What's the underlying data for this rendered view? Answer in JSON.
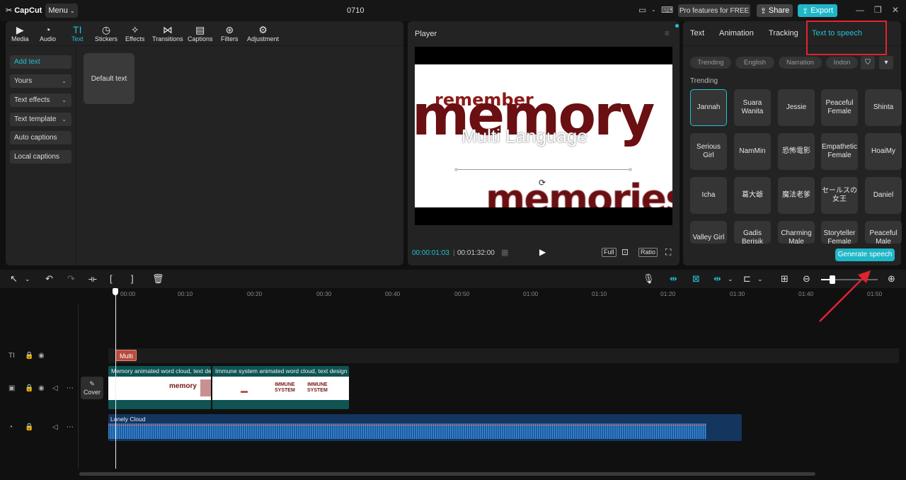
{
  "app": {
    "logo_text": "CapCut",
    "menu_label": "Menu",
    "project_title": "0710",
    "pro_label": "Pro features for FREE",
    "share_label": "Share",
    "export_label": "Export"
  },
  "toolbar": {
    "items": [
      {
        "label": "Media",
        "icon": "media-icon"
      },
      {
        "label": "Audio",
        "icon": "audio-icon"
      },
      {
        "label": "Text",
        "icon": "text-icon"
      },
      {
        "label": "Stickers",
        "icon": "stickers-icon"
      },
      {
        "label": "Effects",
        "icon": "effects-icon"
      },
      {
        "label": "Transitions",
        "icon": "transitions-icon"
      },
      {
        "label": "Captions",
        "icon": "captions-icon"
      },
      {
        "label": "Filters",
        "icon": "filters-icon"
      },
      {
        "label": "Adjustment",
        "icon": "adjustment-icon"
      }
    ],
    "active": "Text"
  },
  "text_sidebar": {
    "items": [
      {
        "label": "Add text"
      },
      {
        "label": "Yours"
      },
      {
        "label": "Text effects"
      },
      {
        "label": "Text template"
      },
      {
        "label": "Auto captions"
      },
      {
        "label": "Local captions"
      }
    ],
    "default_text_card": "Default text"
  },
  "player": {
    "title": "Player",
    "current_time": "00:00:01:03",
    "total_time": "00:01:32:00",
    "full_label": "Full",
    "ratio_label": "Ratio",
    "preview_words": {
      "remember": "remember",
      "memory": "memory",
      "overlay": "Multi Language",
      "memories": "memories"
    }
  },
  "right_panel": {
    "tabs": [
      "Text",
      "Animation",
      "Tracking",
      "Text to speech"
    ],
    "active_tab": "Text to speech",
    "filters": [
      "Trending",
      "English",
      "Narration",
      "Indon"
    ],
    "section_title": "Trending",
    "voices": [
      "Jannah",
      "Suara Wanita",
      "Jessie",
      "Peaceful Female",
      "Shinta",
      "Serious Girl",
      "NamMin",
      "恐怖電影",
      "Empathetic Female",
      "HoaiMy",
      "Icha",
      "葛大爺",
      "魔法老爹",
      "セールスの女王",
      "Daniel",
      "Valley Girl",
      "Gadis Berisik",
      "Charming Male",
      "Storyteller Female",
      "Peaceful Male"
    ],
    "selected_voice": "Jannah",
    "generate_label": "Generate speech"
  },
  "timeline": {
    "ruler": [
      "00:00",
      "00:10",
      "00:20",
      "00:30",
      "00:40",
      "00:50",
      "01:00",
      "01:10",
      "01:20",
      "01:30",
      "01:40",
      "01:50"
    ],
    "text_clip": "Multi",
    "video_clips": [
      "Memory animated word cloud, text design",
      "Immune system animated word cloud, text design"
    ],
    "cover_label": "Cover",
    "audio_clip": "Lonely Cloud"
  },
  "colors": {
    "accent": "#22c1d6",
    "annotation_red": "#e0242e",
    "word_red": "#6a0f12"
  }
}
